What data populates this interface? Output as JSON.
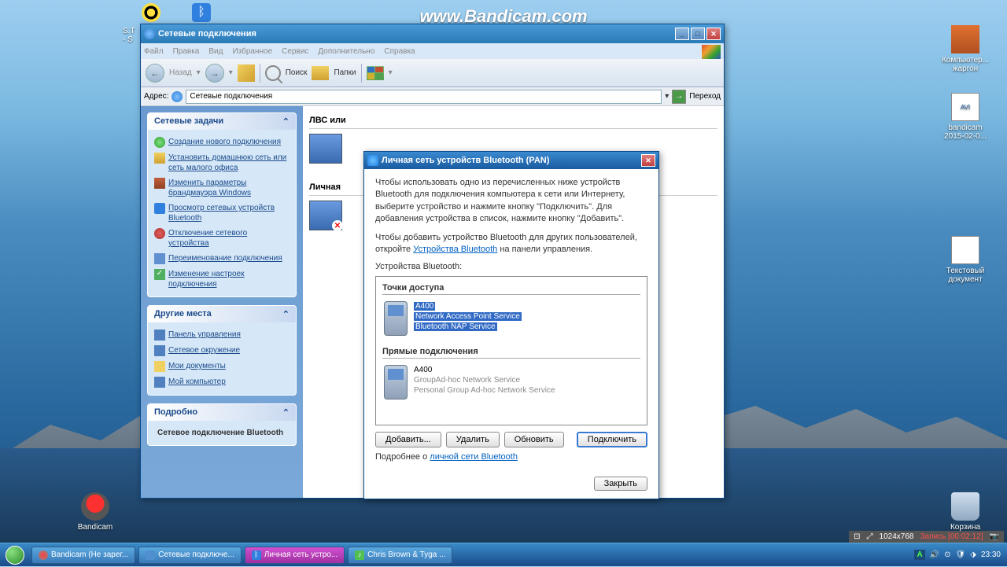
{
  "watermark": "www.Bandicam.com",
  "desktop_icons": {
    "presentation": {
      "label": "Компьютер...\nжаргон"
    },
    "avi": {
      "label": "bandicam\n2015-02-0..."
    },
    "textdoc": {
      "label": "Текстовый\nдокумент"
    },
    "bandicam": {
      "label": "Bandicam"
    },
    "recycle": {
      "label": "Корзина"
    }
  },
  "shortcut_peek": "S.T\n- S",
  "window": {
    "title": "Сетевые подключения",
    "menu": [
      "Файл",
      "Правка",
      "Вид",
      "Избранное",
      "Сервис",
      "Дополнительно",
      "Справка"
    ],
    "toolbar": {
      "back": "Назад",
      "search": "Поиск",
      "folders": "Папки"
    },
    "address_label": "Адрес:",
    "address_value": "Сетевые подключения",
    "go": "Переход",
    "sidebar": {
      "tasks_hdr": "Сетевые задачи",
      "tasks": [
        "Создание нового подключения",
        "Установить домашнюю сеть или сеть малого офиса",
        "Изменить параметры брандмауэра Windows",
        "Просмотр сетевых устройств Bluetooth",
        "Отключение сетевого устройства",
        "Переименование подключения",
        "Изменение настроек подключения"
      ],
      "places_hdr": "Другие места",
      "places": [
        "Панель управления",
        "Сетевое окружение",
        "Мои документы",
        "Мой компьютер"
      ],
      "details_hdr": "Подробно",
      "details_title": "Сетевое подключение Bluetooth"
    },
    "main": {
      "cat1": "ЛВС или",
      "cat2": "Личная"
    }
  },
  "dialog": {
    "title": "Личная сеть устройств Bluetooth (PAN)",
    "text1": "Чтобы использовать одно из перечисленных ниже устройств Bluetooth для подключения компьютера к сети или Интернету, выберите устройство и нажмите кнопку \"Подключить\". Для добавления устройства в список, нажмите кнопку \"Добавить\".",
    "text2_a": "Чтобы добавить устройство Bluetooth для других пользователей, откройте ",
    "text2_link": "Устройства Bluetooth",
    "text2_b": " на панели управления.",
    "devices_label": "Устройства Bluetooth:",
    "group1": "Точки доступа",
    "dev1": {
      "name": "A400",
      "line1": "Network Access Point Service",
      "line2": "Bluetooth NAP Service"
    },
    "group2": "Прямые подключения",
    "dev2": {
      "name": "A400",
      "line1": "GroupAd-hoc Network Service",
      "line2": "Personal Group Ad-hoc Network Service"
    },
    "btn_add": "Добавить...",
    "btn_del": "Удалить",
    "btn_refresh": "Обновить",
    "btn_connect": "Подключить",
    "more_a": "Подробнее о ",
    "more_link": "личной сети Bluetooth",
    "btn_close": "Закрыть"
  },
  "rec_bar": {
    "res": "1024x768",
    "rec": "Запись [00:02:12]"
  },
  "taskbar": {
    "items": [
      "Bandicam (Не зарег...",
      "Сетевые подключе...",
      "Личная сеть устро...",
      "Chris Brown & Tyga ..."
    ],
    "lang": "A",
    "time": "23:30"
  }
}
